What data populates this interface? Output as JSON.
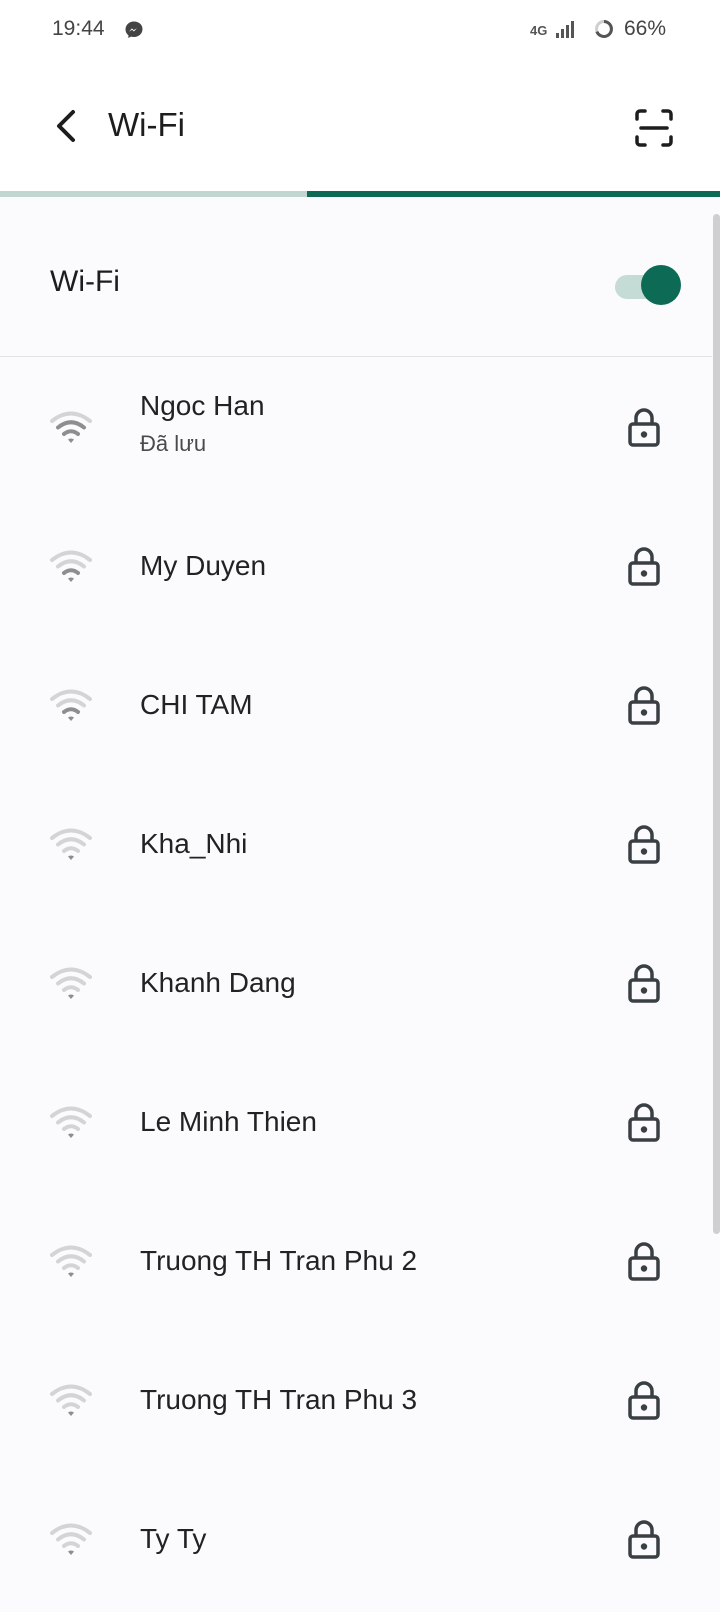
{
  "status_bar": {
    "time": "19:44",
    "network": "4G",
    "battery": "66%"
  },
  "header": {
    "title": "Wi-Fi",
    "back_icon": "chevron-left-icon",
    "scan_icon": "qr-scan-icon"
  },
  "progress": {
    "fraction_complete": 0.43
  },
  "wifi_toggle": {
    "label": "Wi-Fi",
    "enabled": true
  },
  "networks": [
    {
      "ssid": "Ngoc Han",
      "status": "Đã lưu",
      "signal_level": 3,
      "secured": true
    },
    {
      "ssid": "My Duyen",
      "status": "",
      "signal_level": 2,
      "secured": true
    },
    {
      "ssid": "CHI TAM",
      "status": "",
      "signal_level": 2,
      "secured": true
    },
    {
      "ssid": "Kha_Nhi",
      "status": "",
      "signal_level": 1,
      "secured": true
    },
    {
      "ssid": "Khanh Dang",
      "status": "",
      "signal_level": 1,
      "secured": true
    },
    {
      "ssid": "Le Minh Thien",
      "status": "",
      "signal_level": 1,
      "secured": true
    },
    {
      "ssid": "Truong TH Tran Phu 2",
      "status": "",
      "signal_level": 1,
      "secured": true
    },
    {
      "ssid": "Truong TH Tran Phu 3",
      "status": "",
      "signal_level": 1,
      "secured": true
    },
    {
      "ssid": "Ty Ty",
      "status": "",
      "signal_level": 1,
      "secured": true
    }
  ],
  "colors": {
    "accent": "#0d6b55",
    "accent_light": "#c4dcd5",
    "background": "#fbfbfd"
  }
}
